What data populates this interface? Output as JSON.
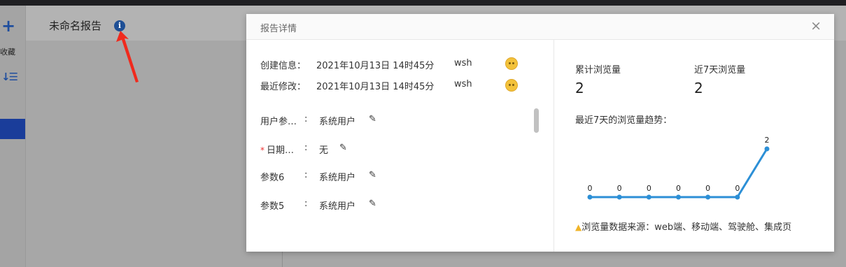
{
  "sidebar": {
    "plus_icon": "+",
    "collect_label": "收藏",
    "sort_icon": "sort-icon"
  },
  "header": {
    "title": "未命名报告"
  },
  "modal": {
    "title": "报告详情",
    "close": "×",
    "created": {
      "label": "创建信息：",
      "time": "2021年10月13日 14时45分",
      "user": "wsh"
    },
    "modified": {
      "label": "最近修改：",
      "time": "2021年10月13日 14时45分",
      "user": "wsh"
    },
    "params": [
      {
        "label": "用户参…",
        "value": "系统用户",
        "required": false
      },
      {
        "label": "日期…",
        "value": "无",
        "required": true
      },
      {
        "label": "参数6",
        "value": "系统用户",
        "required": false
      },
      {
        "label": "参数5",
        "value": "系统用户",
        "required": false
      }
    ],
    "colon": ":",
    "required_mark": "*",
    "stats": {
      "total_label": "累计浏览量",
      "total_value": "2",
      "week_label": "近7天浏览量",
      "week_value": "2"
    },
    "trend_label": "最近7天的浏览量趋势：",
    "source_text": "浏览量数据来源：web端、移动端、驾驶舱、集成页"
  },
  "chart_data": {
    "type": "line",
    "values": [
      0,
      0,
      0,
      0,
      0,
      0,
      2
    ],
    "color": "#2c8fd6"
  }
}
